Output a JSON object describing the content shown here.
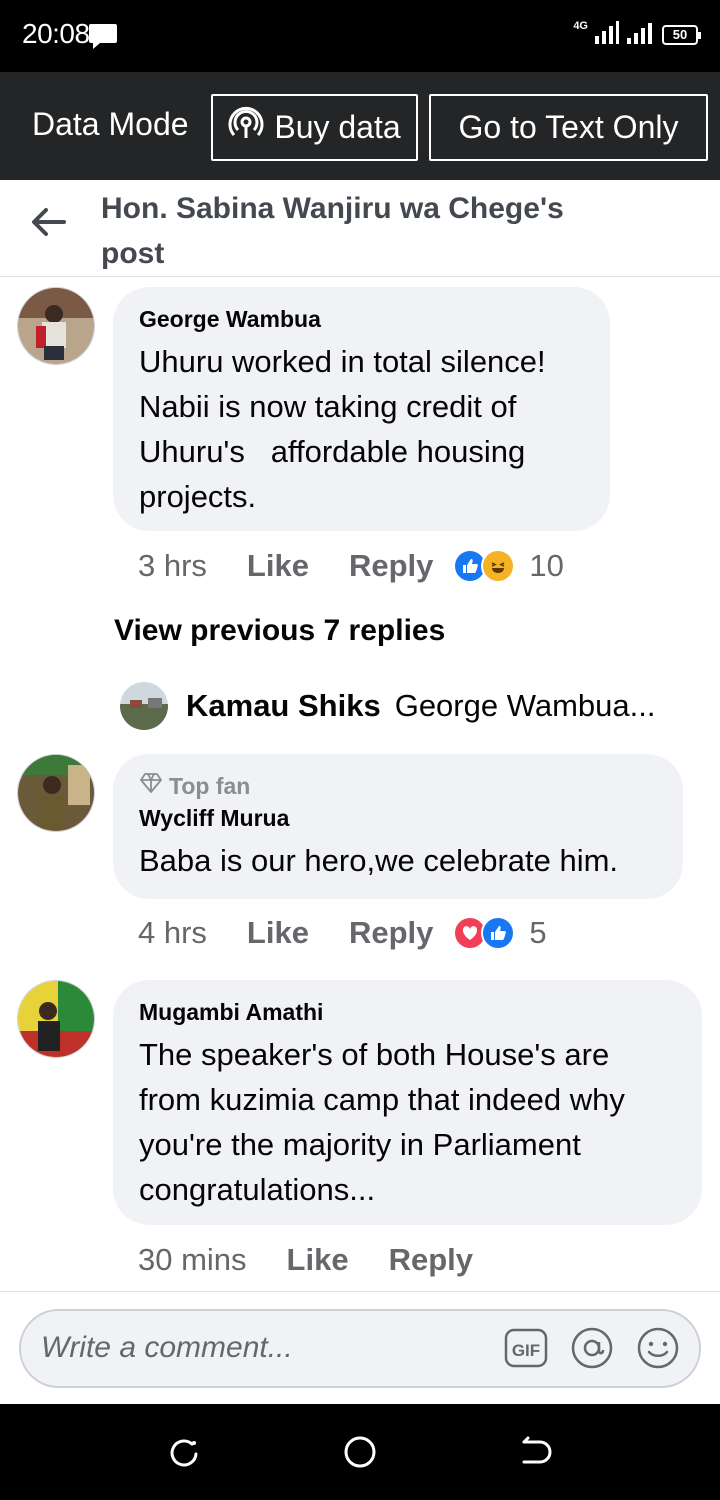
{
  "status_bar": {
    "time": "20:08",
    "network": "4G",
    "battery": "50"
  },
  "data_bar": {
    "label": "Data Mode",
    "buy_data": "Buy data",
    "text_only": "Go to Text Only"
  },
  "header": {
    "title": "Hon. Sabina Wanjiru wa Chege's post"
  },
  "comments": [
    {
      "author": "George Wambua",
      "text": "Uhuru worked in total silence! Nabii is now taking credit of Uhuru's   affordable housing projects.",
      "time": "3 hrs",
      "like": "Like",
      "reply": "Reply",
      "reactions": [
        "like",
        "haha"
      ],
      "reaction_count": "10"
    },
    {
      "badge": "Top fan",
      "author": "Wycliff Murua",
      "text": "Baba is our hero,we celebrate him.",
      "time": "4 hrs",
      "like": "Like",
      "reply": "Reply",
      "reactions": [
        "love",
        "like"
      ],
      "reaction_count": "5"
    },
    {
      "author": "Mugambi Amathi",
      "text": "The speaker's of both House's are from kuzimia camp that indeed why you're the majority in Parliament congratulations...",
      "time": "30 mins",
      "like": "Like",
      "reply": "Reply"
    }
  ],
  "view_previous": "View previous 7 replies",
  "reply_preview": {
    "author": "Kamau Shiks",
    "snippet": "George Wambua..."
  },
  "composer": {
    "placeholder": "Write a comment..."
  },
  "colors": {
    "like_blue": "#1877f2",
    "love_red": "#f33e58",
    "haha_yellow": "#f7b125",
    "bubble": "#f0f2f5",
    "muted": "#65676b"
  }
}
